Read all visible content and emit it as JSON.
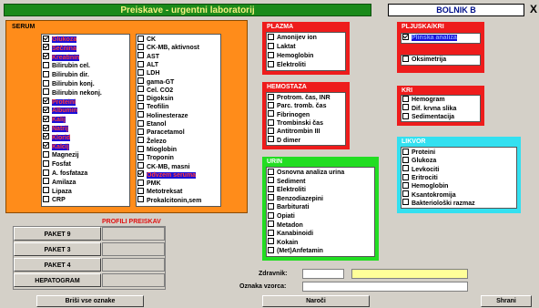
{
  "header": {
    "title": "Preiskave - urgentni laboratorij",
    "patient_label": "BOLNIK B",
    "close_label": "X"
  },
  "serum": {
    "title": "SERUM",
    "left": [
      {
        "label": "Glukoza",
        "checked": true,
        "hl": true
      },
      {
        "label": "Sečnina",
        "checked": true,
        "hl": true
      },
      {
        "label": "Kreatinin",
        "checked": true,
        "hl": true
      },
      {
        "label": "Bilirubin cel.",
        "checked": false,
        "hl": false
      },
      {
        "label": "Bilirubin dir.",
        "checked": false,
        "hl": false
      },
      {
        "label": "Bilirubin konj.",
        "checked": false,
        "hl": false
      },
      {
        "label": "Bilirubin nekonj.",
        "checked": false,
        "hl": false
      },
      {
        "label": "Proteini",
        "checked": true,
        "hl": true
      },
      {
        "label": "Albumin",
        "checked": true,
        "hl": true
      },
      {
        "label": "Kalij",
        "checked": true,
        "hl": true
      },
      {
        "label": "Natrij",
        "checked": true,
        "hl": true
      },
      {
        "label": "Klorid",
        "checked": true,
        "hl": true
      },
      {
        "label": "Kalcij",
        "checked": true,
        "hl": true
      },
      {
        "label": "Magnezij",
        "checked": false,
        "hl": false
      },
      {
        "label": "Fosfat",
        "checked": false,
        "hl": false
      },
      {
        "label": "A. fosfataza",
        "checked": false,
        "hl": false
      },
      {
        "label": "Amilaza",
        "checked": false,
        "hl": false
      },
      {
        "label": "Lipaza",
        "checked": false,
        "hl": false
      },
      {
        "label": "CRP",
        "checked": false,
        "hl": false
      }
    ],
    "right": [
      {
        "label": "CK",
        "checked": false,
        "hl": false
      },
      {
        "label": "CK-MB, aktivnost",
        "checked": false,
        "hl": false
      },
      {
        "label": "AST",
        "checked": false,
        "hl": false
      },
      {
        "label": "ALT",
        "checked": false,
        "hl": false
      },
      {
        "label": "LDH",
        "checked": false,
        "hl": false
      },
      {
        "label": "gama-GT",
        "checked": false,
        "hl": false
      },
      {
        "label": "Cel. CO2",
        "checked": false,
        "hl": false
      },
      {
        "label": "Digoksin",
        "checked": false,
        "hl": false
      },
      {
        "label": "Teofilin",
        "checked": false,
        "hl": false
      },
      {
        "label": "Holinesteraze",
        "checked": false,
        "hl": false
      },
      {
        "label": "Etanol",
        "checked": false,
        "hl": false
      },
      {
        "label": "Paracetamol",
        "checked": false,
        "hl": false
      },
      {
        "label": "Železo",
        "checked": false,
        "hl": false
      },
      {
        "label": "Mioglobin",
        "checked": false,
        "hl": false
      },
      {
        "label": "Troponin",
        "checked": false,
        "hl": false
      },
      {
        "label": "CK-MB, masni",
        "checked": false,
        "hl": false
      },
      {
        "label": "Odvzem seruma",
        "checked": true,
        "hl": true
      },
      {
        "label": "PMK",
        "checked": false,
        "hl": false
      },
      {
        "label": "Metotreksat",
        "checked": false,
        "hl": false
      },
      {
        "label": "Prokalcitonin,sem",
        "checked": false,
        "hl": false
      }
    ]
  },
  "plazma": {
    "title": "PLAZMA",
    "items": [
      {
        "label": "Amonijev ion",
        "checked": false
      },
      {
        "label": "Laktat",
        "checked": false
      },
      {
        "label": "Hemoglobin",
        "checked": false
      },
      {
        "label": "Elektroliti",
        "checked": false
      }
    ]
  },
  "hemostaza": {
    "title": "HEMOSTAZA",
    "items": [
      {
        "label": "Protrom. čas, INR",
        "checked": false
      },
      {
        "label": "Parc. tromb. čas",
        "checked": false
      },
      {
        "label": "Fibrinogen",
        "checked": false
      },
      {
        "label": "Trombinski čas",
        "checked": false
      },
      {
        "label": "Antitrombin III",
        "checked": false
      },
      {
        "label": "D dimer",
        "checked": false
      }
    ]
  },
  "urin": {
    "title": "URIN",
    "items": [
      {
        "label": "Osnovna analiza urina",
        "checked": false
      },
      {
        "label": "Sediment",
        "checked": false
      },
      {
        "label": "Elektroliti",
        "checked": false
      },
      {
        "label": "Benzodiazepini",
        "checked": false
      },
      {
        "label": "Barbiturati",
        "checked": false
      },
      {
        "label": "Opiati",
        "checked": false
      },
      {
        "label": "Metadon",
        "checked": false
      },
      {
        "label": "Kanabinoidi",
        "checked": false
      },
      {
        "label": "Kokain",
        "checked": false
      },
      {
        "label": "(Met)Anfetamin",
        "checked": false
      }
    ]
  },
  "pljuc": {
    "title": "PLJUSKA/KRI",
    "items": [
      {
        "label": "Plinska analiza",
        "checked": true,
        "hl": true
      },
      {
        "label": "Oksimetrija",
        "checked": false,
        "hl": false
      }
    ]
  },
  "kri": {
    "title": "KRI",
    "items": [
      {
        "label": "Hemogram",
        "checked": false
      },
      {
        "label": "Dif. krvna slika",
        "checked": false
      },
      {
        "label": "Sedimentacija",
        "checked": false
      }
    ]
  },
  "likvor": {
    "title": "LIKVOR",
    "items": [
      {
        "label": "Proteini",
        "checked": false
      },
      {
        "label": "Glukoza",
        "checked": false
      },
      {
        "label": "Levkociti",
        "checked": false
      },
      {
        "label": "Eritrociti",
        "checked": false
      },
      {
        "label": "Hemoglobin",
        "checked": false
      },
      {
        "label": "Ksantokromija",
        "checked": false
      },
      {
        "label": "Bakteriološki razmaz",
        "checked": false
      }
    ]
  },
  "profiles": {
    "title": "PROFILI PREISKAV",
    "items": [
      "PAKET 9",
      "PAKET 3",
      "PAKET 4",
      "HEPATOGRAM"
    ]
  },
  "form": {
    "zdravnik_label": "Zdravnik:",
    "zdravnik_value": "",
    "vzorec_label": "Oznaka vzorca:",
    "vzorec_value": ""
  },
  "actions": {
    "clear_label": "Briši vse oznake",
    "order_label": "Naroči",
    "save_label": "Shrani"
  },
  "colors": {
    "orange": "#ff8c1a",
    "red": "#ee1c1c",
    "green": "#22dd22",
    "cyan": "#33e0f0"
  }
}
